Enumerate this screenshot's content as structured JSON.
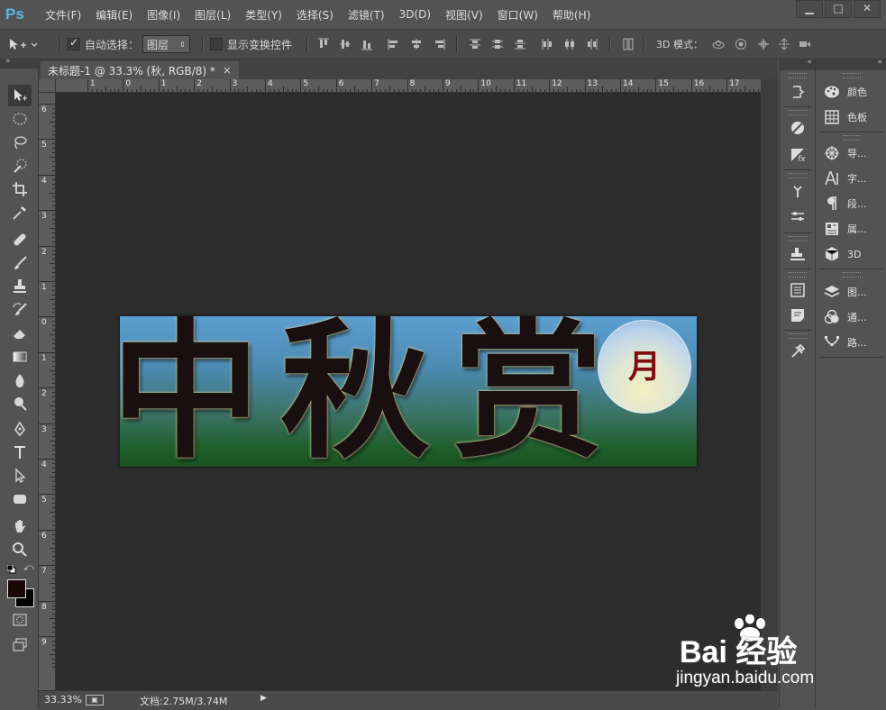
{
  "app": {
    "logo": "Ps",
    "menu": [
      "文件(F)",
      "编辑(E)",
      "图像(I)",
      "图层(L)",
      "类型(Y)",
      "选择(S)",
      "滤镜(T)",
      "3D(D)",
      "视图(V)",
      "窗口(W)",
      "帮助(H)"
    ],
    "window_controls": [
      "▁",
      "□",
      "✕"
    ]
  },
  "options": {
    "auto_select_label": "自动选择：",
    "auto_select_checked": true,
    "layer_select_value": "图层",
    "show_transform_label": "显示变换控件",
    "mode_3d_label": "3D 模式："
  },
  "document": {
    "tab_title": "未标题-1 @ 33.3% (秋, RGB/8) *",
    "tab_close": "×",
    "ruler_top_labels": [
      "1",
      "0",
      "1",
      "2",
      "3",
      "4",
      "5",
      "6",
      "7",
      "8",
      "9",
      "10",
      "11",
      "12",
      "13",
      "14",
      "15",
      "16",
      "17"
    ],
    "ruler_left_labels": [
      "6",
      "5",
      "4",
      "3",
      "2",
      "1",
      "0",
      "1",
      "2",
      "3",
      "4",
      "5",
      "6",
      "7",
      "8",
      "9"
    ]
  },
  "artwork": {
    "chars": [
      "中",
      "秋",
      "赏"
    ],
    "moon_char": "月"
  },
  "status": {
    "zoom": "33.33%",
    "doc_info": "文档:2.75M/3.74M"
  },
  "panels": {
    "items": [
      {
        "label": "颜色",
        "icon": "palette-icon"
      },
      {
        "label": "色板",
        "icon": "swatches-icon"
      },
      {
        "label": "导...",
        "icon": "navigator-icon"
      },
      {
        "label": "字...",
        "icon": "character-icon"
      },
      {
        "label": "段...",
        "icon": "paragraph-icon"
      },
      {
        "label": "属...",
        "icon": "properties-icon"
      },
      {
        "label": "3D",
        "icon": "cube-icon"
      },
      {
        "label": "图...",
        "icon": "layers-icon"
      },
      {
        "label": "通...",
        "icon": "channels-icon"
      },
      {
        "label": "路...",
        "icon": "paths-icon"
      }
    ]
  },
  "watermark": {
    "logo_text": "Bai 经验",
    "sub_text": "jingyan.baidu.com"
  }
}
